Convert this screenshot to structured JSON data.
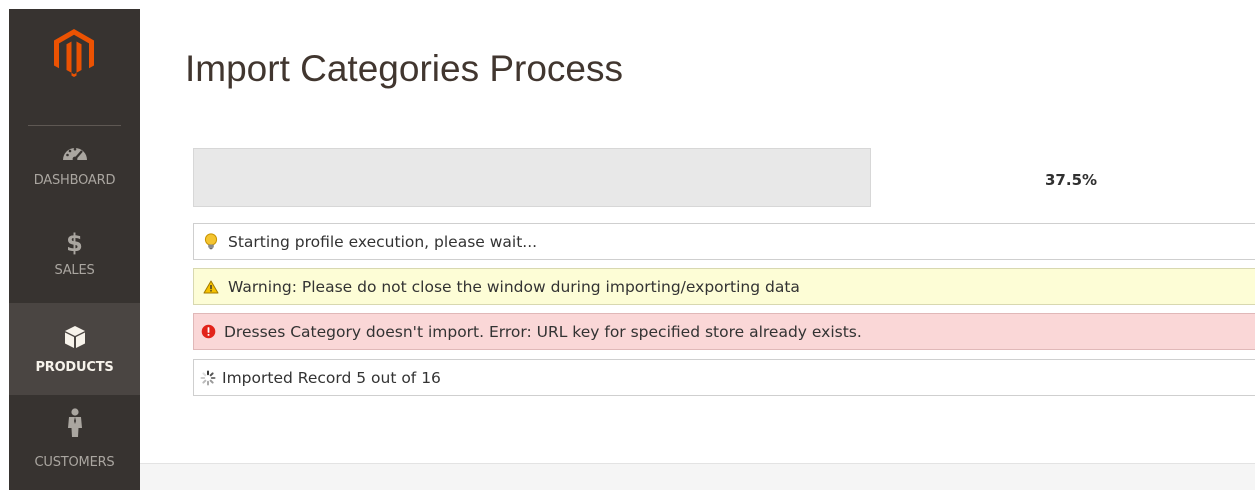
{
  "sidebar": {
    "logo_icon": "magento-logo-icon",
    "items": [
      {
        "label": "DASHBOARD",
        "icon": "speedometer-icon",
        "active": false
      },
      {
        "label": "SALES",
        "icon": "dollar-icon",
        "active": false
      },
      {
        "label": "PRODUCTS",
        "icon": "cube-icon",
        "active": true
      },
      {
        "label": "CUSTOMERS",
        "icon": "person-icon",
        "active": false
      }
    ]
  },
  "main": {
    "title": "Import Categories Process",
    "progress": {
      "fraction": 0.0,
      "label": "37.5%"
    },
    "messages": [
      {
        "type": "info",
        "icon": "lightbulb-icon",
        "text": "Starting profile execution, please wait..."
      },
      {
        "type": "warning",
        "icon": "warning-triangle-icon",
        "text": "Warning: Please do not close the window during importing/exporting data"
      },
      {
        "type": "error",
        "icon": "error-circle-icon",
        "text": "Dresses Category doesn't import. Error: URL key for specified store already exists."
      },
      {
        "type": "progress",
        "icon": "loading-spinner-icon",
        "text": "Imported Record 5 out of 16"
      }
    ]
  },
  "colors": {
    "sidebar_bg": "#373330",
    "sidebar_active_bg": "#4a4542",
    "logo_orange": "#eb5202",
    "warning_bg": "#fdfdd6",
    "error_bg": "#fad7d7",
    "progress_track": "#e8e8e8"
  }
}
